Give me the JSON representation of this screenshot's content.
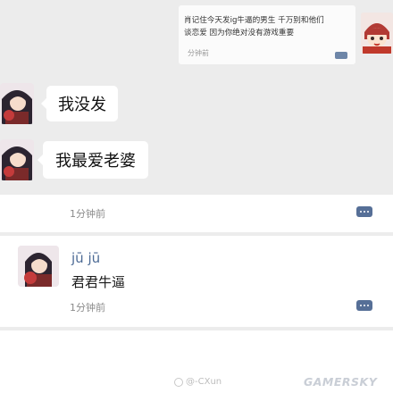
{
  "forwarded": {
    "text_line1": "肖记住今天发ig牛逼的男生 千万别和他们",
    "text_line2": "谈恋爱 因为你绝对没有游戏重要",
    "time": "分钟前"
  },
  "messages": [
    {
      "text": "我没发"
    },
    {
      "text": "我最爱老婆"
    }
  ],
  "comments": [
    {
      "time": "1分钟前"
    },
    {
      "name": "jū jū",
      "text": "君君牛逼",
      "time": "1分钟前"
    }
  ],
  "watermark": {
    "handle": "@-CXun",
    "brand": "GAMERSKY"
  },
  "colors": {
    "name": "#4c6a95",
    "more_button": "#566f97",
    "background": "#ececec"
  }
}
